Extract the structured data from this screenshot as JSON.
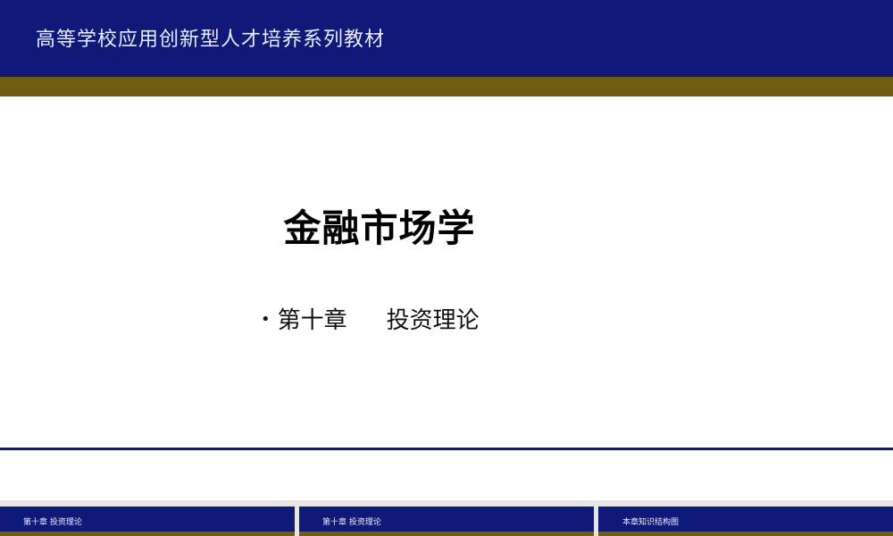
{
  "header": {
    "title": "高等学校应用创新型人才培养系列教材"
  },
  "slide": {
    "title": "金融市场学",
    "bullet": {
      "chapter": "第十章",
      "topic": "投资理论"
    }
  },
  "nav": {
    "items": [
      {
        "label": "第十章    投资理论"
      },
      {
        "label": "第十章    投资理论"
      },
      {
        "label": "本章知识结构图"
      }
    ]
  },
  "colors": {
    "header_blue": "#0f1a78",
    "accent_olive": "#6f5e12",
    "background": "#ffffff"
  }
}
